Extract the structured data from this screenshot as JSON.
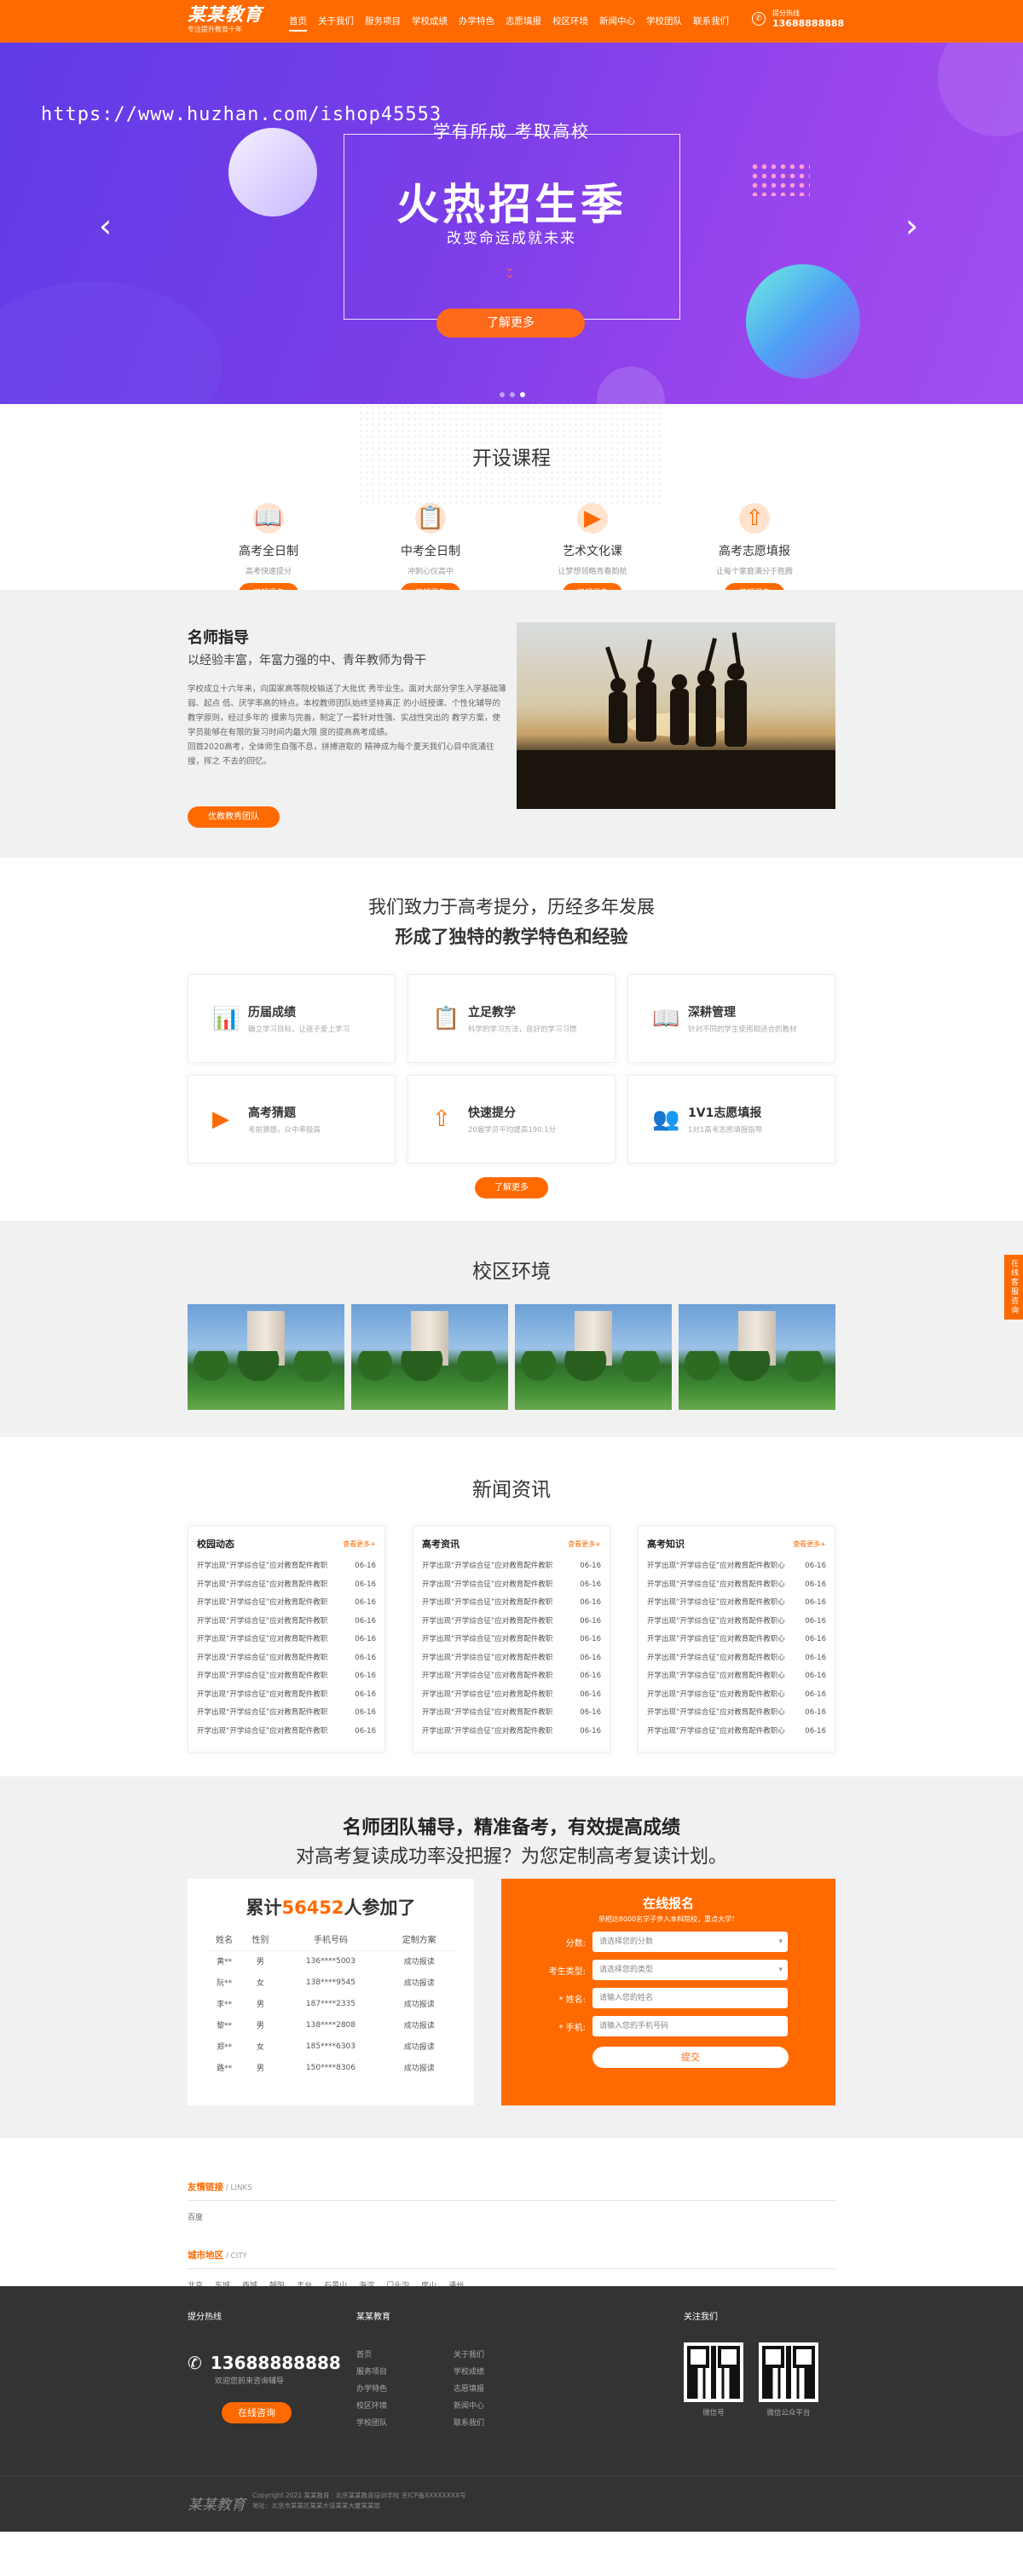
{
  "header": {
    "logo_main": "某某教育",
    "logo_sub": "专注提升教育十年",
    "nav": [
      "首页",
      "关于我们",
      "服务项目",
      "学校成绩",
      "办学特色",
      "志愿填报",
      "校区环境",
      "新闻中心",
      "学校团队",
      "联系我们"
    ],
    "tel_label": "提分热线",
    "tel": "13688888888"
  },
  "banner": {
    "watermark": "https://www.huzhan.com/ishop45553",
    "sub1": "学有所成 考取高校",
    "title": "火热招生季",
    "sub2": "改变命运成就未来",
    "button": "了解更多"
  },
  "courses": {
    "title": "开设课程",
    "items": [
      {
        "icon": "book-icon",
        "name": "高考全日制",
        "desc": "高考快速提分",
        "btn": "了解报名"
      },
      {
        "icon": "board-icon",
        "name": "中考全日制",
        "desc": "冲刺心仪高中",
        "btn": "了解报名"
      },
      {
        "icon": "play-icon",
        "name": "艺术文化课",
        "desc": "让梦想领略青春韵航",
        "btn": "了解报名"
      },
      {
        "icon": "upload-icon",
        "name": "高考志愿填报",
        "desc": "让每个家庭满分于胜腾",
        "btn": "了解报名"
      }
    ]
  },
  "teacher": {
    "title": "名师指导",
    "subtitle": "以经验丰富，年富力强的中、青年教师为骨干",
    "body1": "学校成立十六年来，向国家高等院校输送了大批优 秀毕业生。面对大部分学生入学基础薄弱、起点 低、厌学率高的特点。本校教师团队始终坚持真正 的小班授课、个性化辅导的教学原则，经过多年的 摸索与完善，制定了一套针对性强、实战性突出的 教学方案，使学员能够在有限的复习时间内最大限 度的提高高考成绩。",
    "body2": "回首2020高考，全体师生自强不息，拼搏进取的 精神成为每个夏天我们心目中底涌往搜，挥之 不去的回忆。",
    "button": "优教教秀团队"
  },
  "features": {
    "title1": "我们致力于高考提分，历经多年发展",
    "title2": "形成了独特的教学特色和经验",
    "cards": [
      {
        "icon": "chart-icon",
        "name": "历届成绩",
        "desc": "确立学习目标，让孩子爱上学习"
      },
      {
        "icon": "teacher-icon",
        "name": "立足教学",
        "desc": "科学的学习方法，良好的学习习惯"
      },
      {
        "icon": "book-icon",
        "name": "深耕管理",
        "desc": "针对不同的学生使用相适合的教材"
      },
      {
        "icon": "play-icon",
        "name": "高考猜题",
        "desc": "考前猜题，众中率极高"
      },
      {
        "icon": "upload-icon",
        "name": "快速提分",
        "desc": "20届学员平均提高190.1分"
      },
      {
        "icon": "users-icon",
        "name": "1V1志愿填报",
        "desc": "1对1高考志愿填报指导"
      }
    ],
    "button": "了解更多"
  },
  "campus": {
    "title": "校区环境"
  },
  "news": {
    "title": "新闻资讯",
    "more": "查看更多+",
    "cols": [
      {
        "name": "校园动态",
        "items": [
          "开学出现“开学综合征”应对教育配件教职",
          "开学出现“开学综合征”应对教育配件教职",
          "开学出现“开学综合征”应对教育配件教职",
          "开学出现“开学综合征”应对教育配件教职",
          "开学出现“开学综合征”应对教育配件教职",
          "开学出现“开学综合征”应对教育配件教职",
          "开学出现“开学综合征”应对教育配件教职",
          "开学出现“开学综合征”应对教育配件教职",
          "开学出现“开学综合征”应对教育配件教职",
          "开学出现“开学综合征”应对教育配件教职"
        ]
      },
      {
        "name": "高考资讯",
        "items": [
          "开学出现“开学综合征”应对教育配件教职",
          "开学出现“开学综合征”应对教育配件教职",
          "开学出现“开学综合征”应对教育配件教职",
          "开学出现“开学综合征”应对教育配件教职",
          "开学出现“开学综合征”应对教育配件教职",
          "开学出现“开学综合征”应对教育配件教职",
          "开学出现“开学综合征”应对教育配件教职",
          "开学出现“开学综合征”应对教育配件教职",
          "开学出现“开学综合征”应对教育配件教职",
          "开学出现“开学综合征”应对教育配件教职"
        ]
      },
      {
        "name": "高考知识",
        "items": [
          "开学出现“开学综合征”应对教育配件教职心",
          "开学出现“开学综合征”应对教育配件教职心",
          "开学出现“开学综合征”应对教育配件教职心",
          "开学出现“开学综合征”应对教育配件教职心",
          "开学出现“开学综合征”应对教育配件教职心",
          "开学出现“开学综合征”应对教育配件教职心",
          "开学出现“开学综合征”应对教育配件教职心",
          "开学出现“开学综合征”应对教育配件教职心",
          "开学出现“开学综合征”应对教育配件教职心",
          "开学出现“开学综合征”应对教育配件教职心"
        ]
      }
    ],
    "date": "06-16"
  },
  "apply": {
    "title1": "名师团队辅导，精准备考，有效提高成绩",
    "title2": "对高考复读成功率没把握？为您定制高考复读计划。",
    "count_pre": "累计",
    "count": "56452",
    "count_post": "人参加了",
    "headers": [
      "姓名",
      "性别",
      "手机号码",
      "定制方案"
    ],
    "rows": [
      [
        "黄**",
        "男",
        "136****5003",
        "成功报读"
      ],
      [
        "阮**",
        "女",
        "138****9545",
        "成功报读"
      ],
      [
        "李**",
        "男",
        "187****2335",
        "成功报读"
      ],
      [
        "黎**",
        "男",
        "138****2808",
        "成功报读"
      ],
      [
        "郑**",
        "女",
        "185****6303",
        "成功报读"
      ],
      [
        "路**",
        "男",
        "150****8306",
        "成功报读"
      ]
    ],
    "form_title": "在线报名",
    "form_sub": "单相达8000名学子步入本科院校，重点大学！",
    "fields": [
      {
        "label": "分数:",
        "placeholder": "请选择您的分数",
        "select": true
      },
      {
        "label": "考生类型:",
        "placeholder": "请选择您的类型",
        "select": true
      },
      {
        "label": "* 姓名:",
        "placeholder": "请输入您的姓名",
        "select": false
      },
      {
        "label": "* 手机:",
        "placeholder": "请输入您的手机号码",
        "select": false
      }
    ],
    "submit": "提交"
  },
  "links": {
    "t1": "友情链接",
    "t1s": " / LINKS",
    "items1": [
      "百度"
    ],
    "t2": "城市地区",
    "t2s": " / CITY",
    "items2": [
      "北京",
      "东城",
      "西城",
      "朝阳",
      "丰台",
      "石景山",
      "海淀",
      "门头沟",
      "房山",
      "通州"
    ]
  },
  "side": "在线客服咨询",
  "footer": {
    "hotline": "提分热线",
    "tel": "13688888888",
    "tel_sub": "欢迎您前来咨询辅导",
    "online": "在线咨询",
    "brand": "某某教育",
    "menu": [
      "首页",
      "关于我们",
      "服务项目",
      "学校成绩",
      "办学特色",
      "志愿填报",
      "校区环境",
      "新闻中心",
      "学校团队",
      "联系我们"
    ],
    "follow": "关注我们",
    "qr1": "微信号",
    "qr2": "微信公众平台",
    "logo": "某某教育",
    "copyright1": "Copyright 2021 某某教育 · 北京某某教育培训学校    京ICP备XXXXXXXX号",
    "copyright2": "地址：北京市某某区某某大道某某大厦某某层"
  }
}
